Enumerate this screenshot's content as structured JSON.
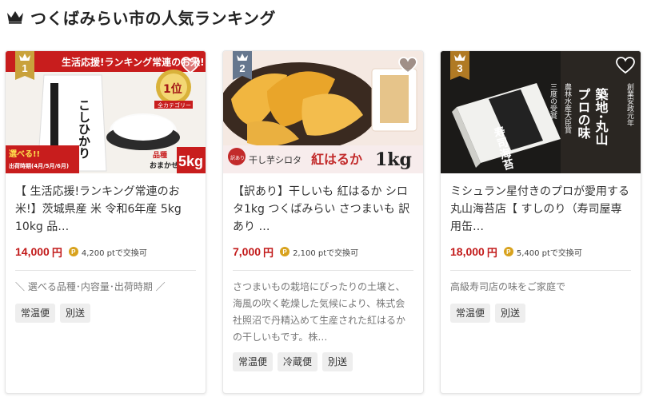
{
  "header": {
    "title": "つくばみらい市の人気ランキング"
  },
  "colors": {
    "rank1": "#c9a23c",
    "rank2": "#66778e",
    "rank3": "#b07a24",
    "price": "#c21a1a",
    "point": "#d8a21d"
  },
  "cards": [
    {
      "rank": "1",
      "name": "【 生活応援!ランキング常連のお米!】茨城県産 米 令和6年産 5kg 10kg 品…",
      "price": "14,000",
      "yen": "円",
      "point_icon": "P",
      "points": "4,200 ptで交換可",
      "desc": "＼ 選べる品種･内容量･出荷時期 ／",
      "tags": [
        "常温便",
        "別送"
      ],
      "image": {
        "banner": "生活応援!ランキング常連のお米!",
        "bag_text": "こしひかり",
        "ship_text": "選べる!!",
        "ship_sub": "出荷時期(4月/5月/6月)",
        "variety": "品種",
        "variety2": "おまかせ",
        "weight": "5kg",
        "badge": "1位",
        "category": "全カテゴリー"
      }
    },
    {
      "rank": "2",
      "name": "【訳あり】干しいも 紅はるか シロタ1kg つくばみらい さつまいも 訳あり …",
      "price": "7,000",
      "yen": "円",
      "point_icon": "P",
      "points": "2,100 ptで交換可",
      "desc": "さつまいもの栽培にぴったりの土壌と、海風の吹く乾燥した気候により、株式会社照沼で丹精込めて生産された紅はるかの干しいもです。株…",
      "tags": [
        "常温便",
        "冷蔵便",
        "別送"
      ],
      "image": {
        "stamp": "訳あり",
        "label": "干し芋シロタ",
        "brand": "紅はるか",
        "weight": "1kg"
      }
    },
    {
      "rank": "3",
      "name": "ミシュラン星付きのプロが愛用する 丸山海苔店【 すしのり（寿司屋専用缶…",
      "price": "18,000",
      "yen": "円",
      "point_icon": "P",
      "points": "5,400 ptで交換可",
      "desc": "高級寿司店の味をご家庭で",
      "tags": [
        "常温便",
        "別送"
      ],
      "image": {
        "line1": "築地･丸山",
        "line2": "プロの味",
        "side1": "創業安政元年",
        "side2": "農林水産大臣賞",
        "side3": "三度の受賞",
        "can_text": "寿司海苔"
      }
    }
  ]
}
